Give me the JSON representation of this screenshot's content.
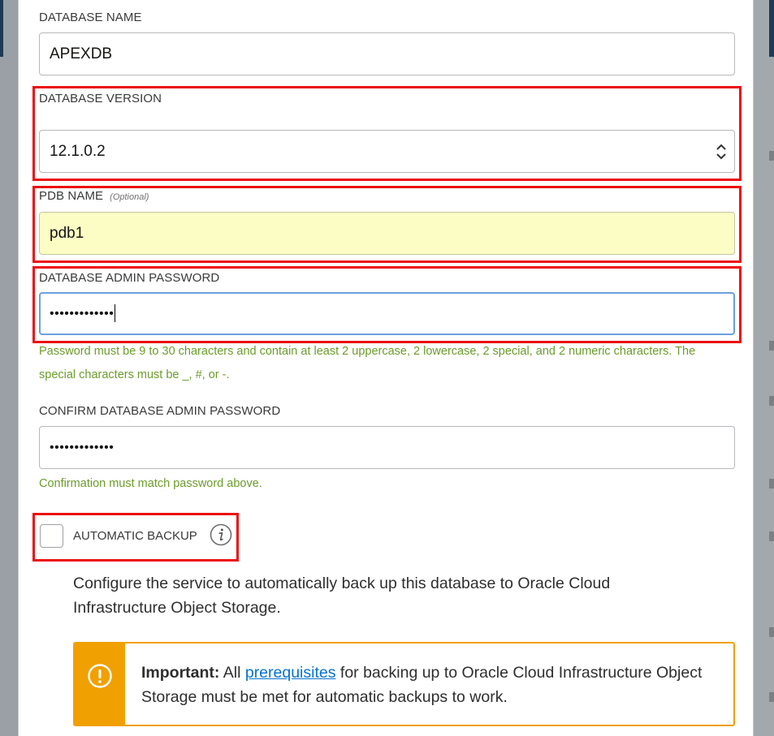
{
  "form": {
    "database_name": {
      "label": "DATABASE NAME",
      "value": "APEXDB"
    },
    "database_version": {
      "label": "DATABASE VERSION",
      "value": "12.1.0.2"
    },
    "pdb_name": {
      "label": "PDB NAME",
      "optional_tag": "(Optional)",
      "value": "pdb1"
    },
    "admin_password": {
      "label": "DATABASE ADMIN PASSWORD",
      "masked_value": "•••••••••••••",
      "hint": "Password must be 9 to 30 characters and contain at least 2 uppercase, 2 lowercase, 2 special, and 2 numeric characters. The special characters must be _, #, or -."
    },
    "confirm_password": {
      "label": "CONFIRM DATABASE ADMIN PASSWORD",
      "masked_value": "•••••••••••••",
      "hint": "Confirmation must match password above."
    },
    "automatic_backup": {
      "label": "AUTOMATIC BACKUP",
      "checked": false,
      "description": "Configure the service to automatically back up this database to Oracle Cloud Infrastructure Object Storage."
    },
    "alert": {
      "strong": "Important:",
      "text_before": " All ",
      "link": "prerequisites",
      "text_after": " for backing up to Oracle Cloud Infrastructure Object Storage must be met for automatic backups to work."
    }
  },
  "colors": {
    "highlight_box": "#ec0f0f",
    "hint_text": "#6b9c2a",
    "warning": "#f0a000",
    "focus_border": "#6aa0df",
    "optional_field_bg": "#fbfdc4",
    "link": "#0572ce"
  },
  "icons": {
    "select": "chevron-up-down-icon",
    "info": "info-icon",
    "warning": "exclamation-circle-icon"
  }
}
